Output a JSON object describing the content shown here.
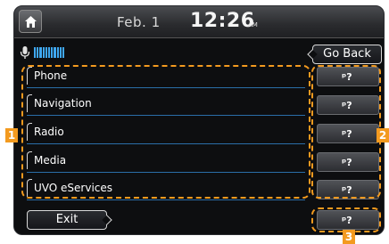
{
  "status": {
    "date": "Feb.  1",
    "time": "12:26",
    "ampm": "AM",
    "home_icon": "home-icon"
  },
  "header": {
    "mic_icon": "microphone-icon",
    "go_back_label": "Go Back"
  },
  "menu": {
    "items": [
      {
        "label": "Phone"
      },
      {
        "label": "Navigation"
      },
      {
        "label": "Radio"
      },
      {
        "label": "Media"
      },
      {
        "label": "UVO eServices"
      }
    ]
  },
  "footer": {
    "exit_label": "Exit"
  },
  "help_icon": "voice-help-icon",
  "callouts": {
    "badge1": "1",
    "badge2": "2",
    "badge3": "3",
    "color": "#f39a1f"
  },
  "colors": {
    "accent": "#3fa7f0",
    "divider": "#2a6ea8"
  }
}
